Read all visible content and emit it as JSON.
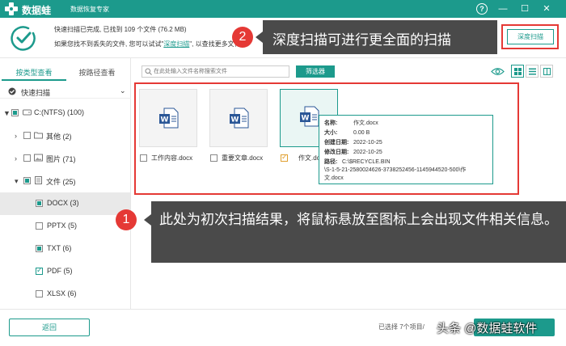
{
  "app": {
    "name": "数据蛙",
    "subtitle": "数据恢复专家",
    "help": "?",
    "minimize": "—",
    "maximize": "☐",
    "close": "✕",
    "brand_color": "#1c9a8c"
  },
  "status": {
    "line1": "快速扫描已完成, 已找到 109 个文件 (76.2 MB)",
    "line2_prefix": "如果您找不到丢失的文件, 您可以试试\"",
    "line2_link": "深度扫描",
    "line2_suffix": "\", 以查找更多文件。",
    "deep_scan_button": "深度扫描"
  },
  "sidebar": {
    "tabs": [
      {
        "label": "按类型查看",
        "active": true
      },
      {
        "label": "按路径查看",
        "active": false
      }
    ],
    "quick_scan": "快速扫描",
    "tree": [
      {
        "label": "C:(NTFS) (100)",
        "arrow": "▼",
        "check": "partial",
        "icon": "drive-icon"
      },
      {
        "label": "其他 (2)",
        "arrow": "›",
        "check": "none",
        "icon": "folder-icon"
      },
      {
        "label": "图片 (71)",
        "arrow": "›",
        "check": "none",
        "icon": "image-icon"
      },
      {
        "label": "文件 (25)",
        "arrow": "▾",
        "check": "partial",
        "icon": "file-icon"
      },
      {
        "label": "DOCX (3)",
        "check": "partial",
        "selected": true
      },
      {
        "label": "PPTX (5)",
        "check": "none"
      },
      {
        "label": "TXT (6)",
        "check": "partial"
      },
      {
        "label": "PDF (5)",
        "check": "checked"
      },
      {
        "label": "XLSX (6)",
        "check": "none"
      }
    ]
  },
  "toolbar": {
    "search_placeholder": "在此处输入文件名称搜索文件",
    "filter_button": "筛选器"
  },
  "files": [
    {
      "name": "工作内容.docx",
      "checked": false
    },
    {
      "name": "重要文章.docx",
      "checked": false
    },
    {
      "name": "作文.docx",
      "checked": true
    }
  ],
  "tooltip": {
    "name_key": "名称:",
    "name_val": "作文.docx",
    "size_key": "大小:",
    "size_val": "0.00 B",
    "created_key": "创建日期:",
    "created_val": "2022-10-25",
    "modified_key": "修改日期:",
    "modified_val": "2022-10-25",
    "path_key": "路径:",
    "path_line1": "C:\\$RECYCLE.BIN",
    "path_line2": "\\S-1-5-21-2580024626-3738252456-1145944520-500\\作",
    "path_line3": "文.docx"
  },
  "callouts": {
    "badge2": "2",
    "text2": "深度扫描可进行更全面的扫描",
    "badge1": "1",
    "text1": "此处为初次扫描结果，将鼠标悬放至图标上会出现文件相关信息。"
  },
  "footer": {
    "back_button": "返回",
    "selected_text": "已选择 7个项目/",
    "watermark": "头条 @数据蛙软件"
  }
}
